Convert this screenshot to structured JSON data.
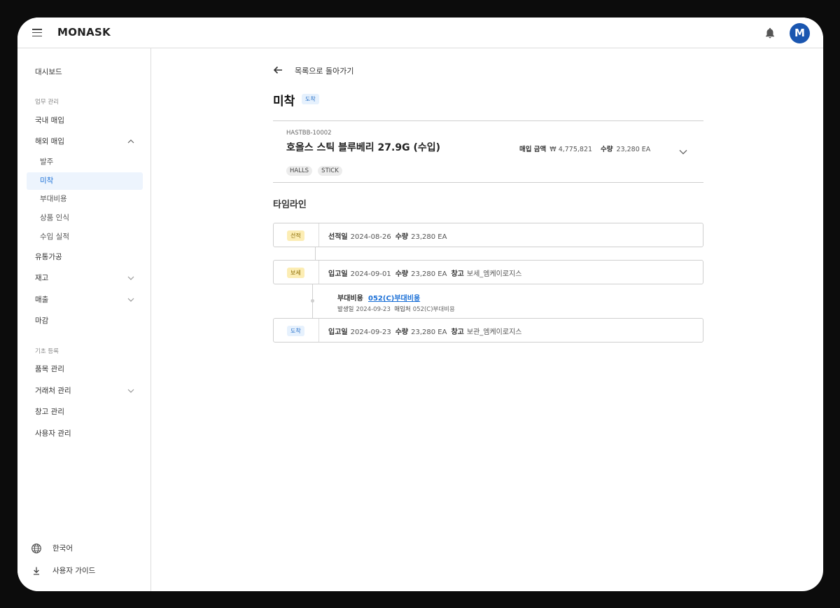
{
  "app": {
    "brand": "MONASK",
    "avatar_initial": "M",
    "accent": "#1a56b0"
  },
  "sidebar": {
    "dashboard": "대시보드",
    "section_work": "업무 관리",
    "domestic": "국내 매입",
    "overseas": "해외 매입",
    "sub": {
      "order": "발주",
      "pending": "미착",
      "extra_cost": "부대비용",
      "product_recognition": "상품 인식",
      "import_record": "수입 실적"
    },
    "distribution": "유통가공",
    "inventory": "재고",
    "sales": "매출",
    "closing": "마감",
    "section_base": "기초 등록",
    "items": "품목 관리",
    "partners": "거래처 관리",
    "warehouse": "창고 관리",
    "users": "사용자 관리",
    "language": "한국어",
    "guide": "사용자 가이드"
  },
  "main": {
    "back_label": "목록으로 돌아가기",
    "title": "미착",
    "title_badge": "도착",
    "card": {
      "code": "HASTBB-10002",
      "name": "호올스 스틱 블루베리 27.9G (수입)",
      "tags": [
        "HALLS",
        "STICK"
      ],
      "amount_label": "매입 금액",
      "amount_value": "₩ 4,775,821",
      "qty_label": "수량",
      "qty_value": "23,280 EA"
    },
    "timeline_title": "타임라인",
    "timeline": [
      {
        "badge": "선적",
        "date_label": "선적일",
        "date": "2024-08-26",
        "qty_label": "수량",
        "qty": "23,280 EA",
        "wh_label": "",
        "wh": ""
      },
      {
        "badge": "보세",
        "date_label": "입고일",
        "date": "2024-09-01",
        "qty_label": "수량",
        "qty": "23,280 EA",
        "wh_label": "창고",
        "wh": "보세_엠케이로지스"
      },
      {
        "badge": "도착",
        "date_label": "입고일",
        "date": "2024-09-23",
        "qty_label": "수량",
        "qty": "23,280 EA",
        "wh_label": "창고",
        "wh": "보관_엠케이로지스"
      }
    ],
    "extra_cost": {
      "label": "부대비용",
      "link": "052(C)부대비용",
      "date_label": "발생일",
      "date": "2024-09-23",
      "vendor_label": "매입처",
      "vendor": "052(C)부대비용"
    }
  }
}
